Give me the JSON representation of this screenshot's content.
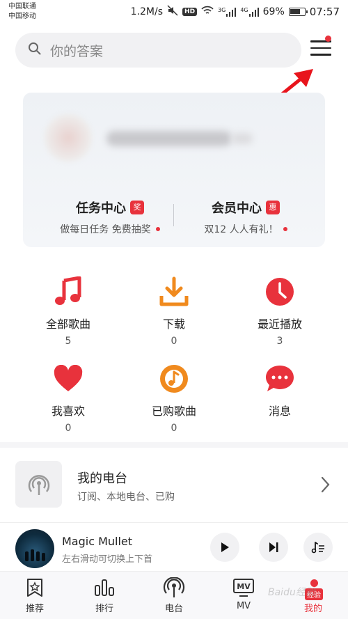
{
  "status_bar": {
    "carrier1": "中国联通",
    "carrier2": "中国移动",
    "speed": "1.2M/s",
    "hd": "HD",
    "net1": "3G",
    "net2": "4G",
    "battery": "69%",
    "time": "07:57"
  },
  "search": {
    "placeholder": "你的答案"
  },
  "card": {
    "task": {
      "title": "任务中心",
      "badge": "奖",
      "sub": "做每日任务 免费抽奖"
    },
    "vip": {
      "title": "会员中心",
      "badge": "惠",
      "sub": "双12 人人有礼！"
    }
  },
  "grid": [
    {
      "label": "全部歌曲",
      "count": "5"
    },
    {
      "label": "下载",
      "count": "0"
    },
    {
      "label": "最近播放",
      "count": "3"
    },
    {
      "label": "我喜欢",
      "count": "0"
    },
    {
      "label": "已购歌曲",
      "count": "0"
    },
    {
      "label": "消息"
    }
  ],
  "radio": {
    "title": "我的电台",
    "subtitle": "订阅、本地电台、已购"
  },
  "player": {
    "song": "Magic Mullet",
    "hint": "左右滑动可切换上下首"
  },
  "tabs": [
    {
      "label": "推荐"
    },
    {
      "label": "排行"
    },
    {
      "label": "电台"
    },
    {
      "label": "MV"
    },
    {
      "label": "我的"
    }
  ],
  "tab_badge": "经验",
  "watermark": "Baidu经验",
  "colors": {
    "accent": "#e8323c",
    "download": "#f08a1e"
  }
}
